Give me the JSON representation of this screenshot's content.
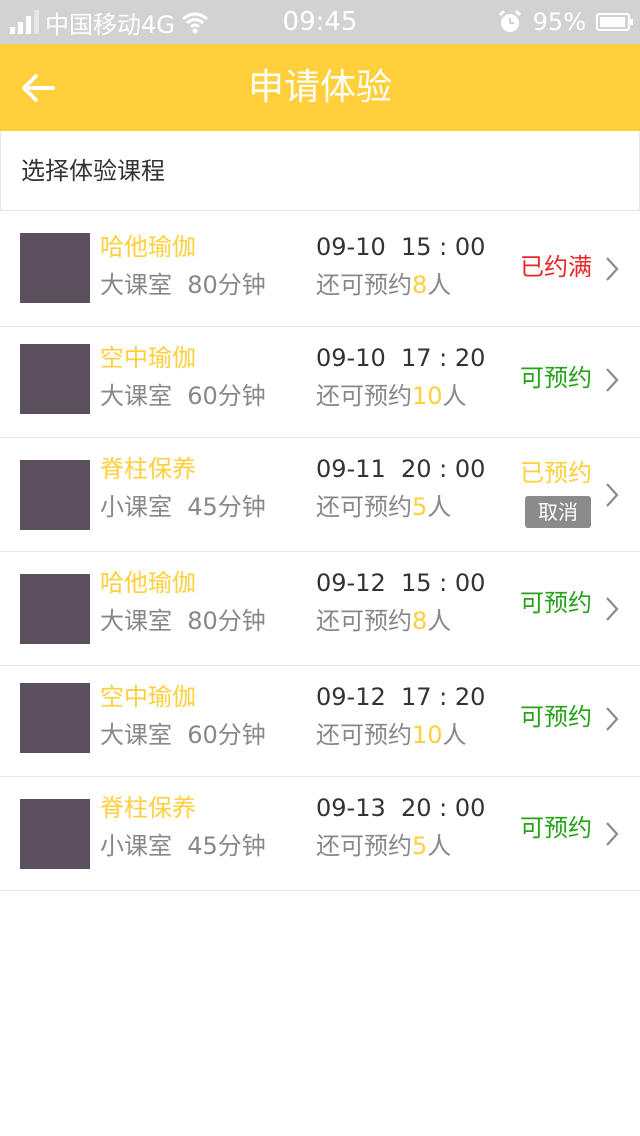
{
  "status_bar": {
    "carrier": "中国移动4G",
    "time": "09:45",
    "battery": "95%"
  },
  "navbar": {
    "title": "申请体验",
    "back_icon": "arrow-left-icon"
  },
  "section": {
    "title": "选择体验课程"
  },
  "colors": {
    "accent": "#ffcf3c",
    "full": "#e8262a",
    "open": "#25a317",
    "cancel_bg": "#8b8b8b"
  },
  "courses": [
    {
      "name": "哈他瑜伽",
      "meta": "大课室  80分钟",
      "time": "09-10  15 : 00",
      "remain_prefix": "还可预约",
      "remain_count": "8",
      "remain_suffix": "人",
      "status": "已约满"
    },
    {
      "name": "空中瑜伽",
      "meta": "大课室  60分钟",
      "time": "09-10  17 : 20",
      "remain_prefix": "还可预约",
      "remain_count": "10",
      "remain_suffix": "人",
      "status": "可预约"
    },
    {
      "name": "脊柱保养",
      "meta": "小课室  45分钟",
      "time": "09-11  20 : 00",
      "remain_prefix": "还可预约",
      "remain_count": "5",
      "remain_suffix": "人",
      "status": "已预约",
      "cancel_label": "取消"
    },
    {
      "name": "哈他瑜伽",
      "meta": "大课室  80分钟",
      "time": "09-12  15 : 00",
      "remain_prefix": "还可预约",
      "remain_count": "8",
      "remain_suffix": "人",
      "status": "可预约"
    },
    {
      "name": "空中瑜伽",
      "meta": "大课室  60分钟",
      "time": "09-12  17 : 20",
      "remain_prefix": "还可预约",
      "remain_count": "10",
      "remain_suffix": "人",
      "status": "可预约"
    },
    {
      "name": "脊柱保养",
      "meta": "小课室  45分钟",
      "time": "09-13  20 : 00",
      "remain_prefix": "还可预约",
      "remain_count": "5",
      "remain_suffix": "人",
      "status": "可预约"
    }
  ]
}
